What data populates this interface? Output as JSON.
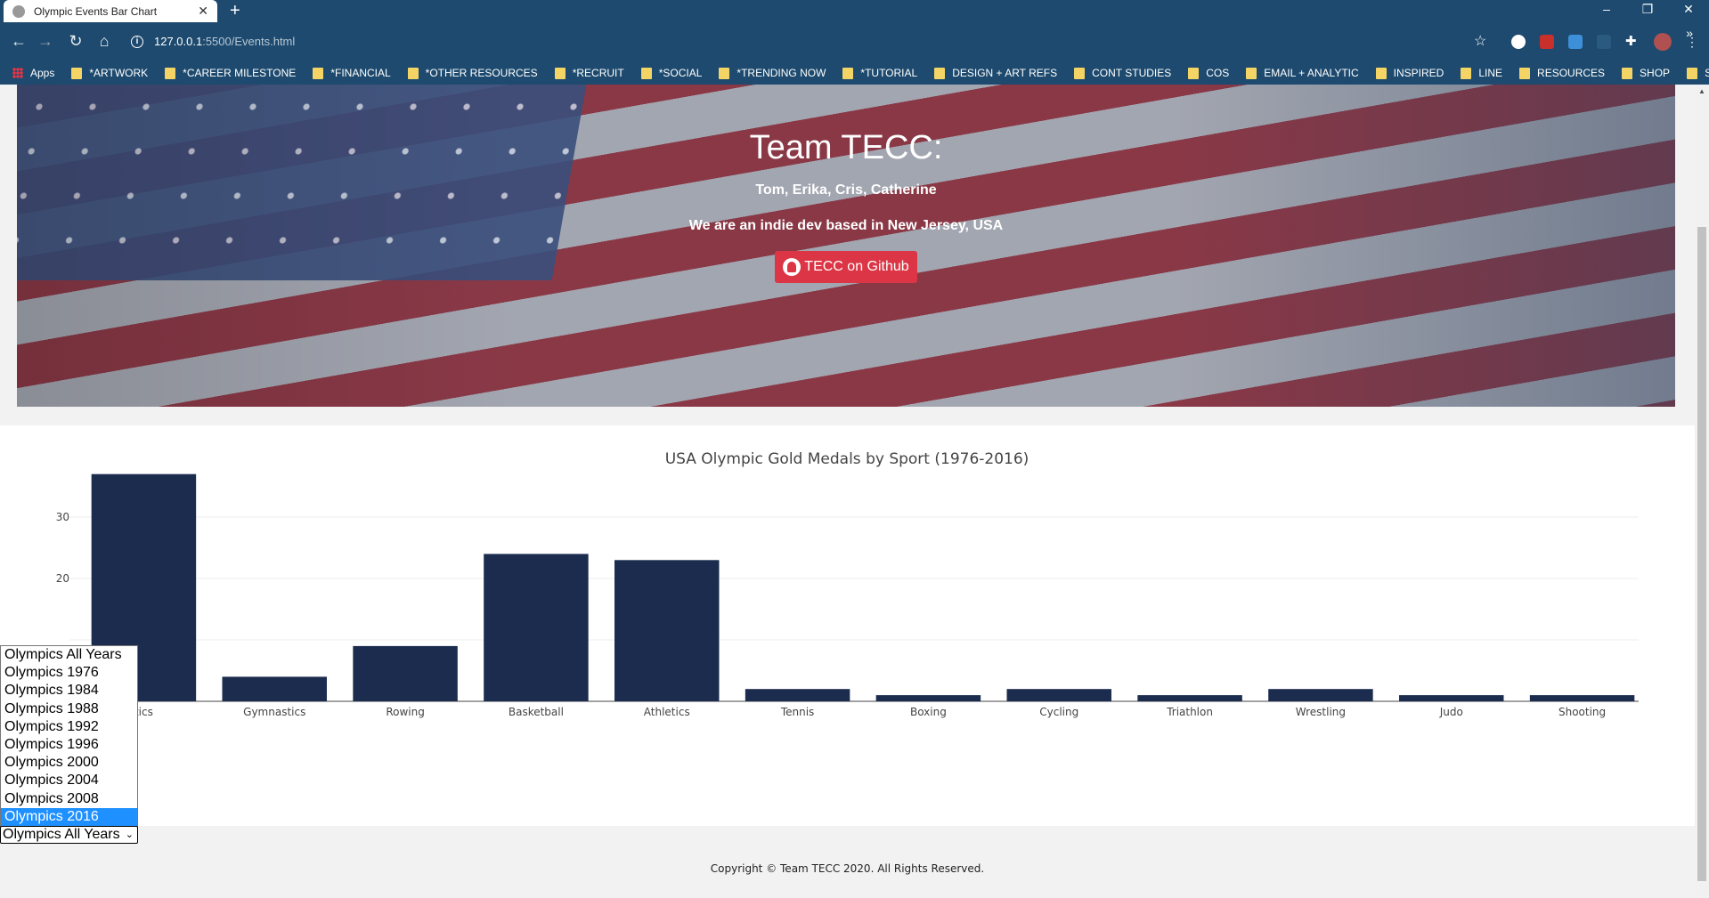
{
  "browser": {
    "tab_title": "Olympic Events Bar Chart",
    "url_host": "127.0.0.1",
    "url_rest": ":5500/Events.html",
    "bookmarks": [
      "Apps",
      "*ARTWORK",
      "*CAREER MILESTONE",
      "*FINANCIAL",
      "*OTHER RESOURCES",
      "*RECRUIT",
      "*SOCIAL",
      "*TRENDING NOW",
      "*TUTORIAL",
      "DESIGN + ART REFS",
      "CONT STUDIES",
      "COS",
      "EMAIL + ANALYTIC",
      "INSPIRED",
      "LINE",
      "RESOURCES",
      "SHOP",
      "SHOWS"
    ]
  },
  "hero": {
    "title": "Team TECC:",
    "members": "Tom, Erika, Cris, Catherine",
    "description": "We are an indie dev based in New Jersey, USA",
    "github_label": "TECC on Github"
  },
  "dropdown": {
    "options": [
      "Olympics All Years",
      "Olympics 1976",
      "Olympics 1984",
      "Olympics 1988",
      "Olympics 1992",
      "Olympics 1996",
      "Olympics 2000",
      "Olympics 2004",
      "Olympics 2008",
      "Olympics 2016"
    ],
    "highlighted": "Olympics 2016",
    "selected": "Olympics All Years"
  },
  "footer": {
    "copyright": "Copyright © Team TECC 2020. All Rights Reserved."
  },
  "colors": {
    "bar": "#1b2c4f",
    "button": "#dc3545",
    "selected_option": "#1e90ff"
  },
  "chart_data": {
    "type": "bar",
    "title": "USA Olympic Gold Medals by Sport (1976-2016)",
    "categories": [
      "Aquatics",
      "Gymnastics",
      "Rowing",
      "Basketball",
      "Athletics",
      "Tennis",
      "Boxing",
      "Cycling",
      "Triathlon",
      "Wrestling",
      "Judo",
      "Shooting"
    ],
    "visible_category_labels": [
      "tics",
      "Gymnastics",
      "Rowing",
      "Basketball",
      "Athletics",
      "Tennis",
      "Boxing",
      "Cycling",
      "Triathlon",
      "Wrestling",
      "Judo",
      "Shooting"
    ],
    "values": [
      37,
      4,
      9,
      24,
      23,
      2,
      1,
      2,
      1,
      2,
      1,
      1
    ],
    "yticks": [
      10,
      20,
      30
    ],
    "visible_yticks": [
      "20",
      "30"
    ],
    "ylim": [
      0,
      39
    ],
    "grid": true,
    "xlabel": "",
    "ylabel": ""
  }
}
